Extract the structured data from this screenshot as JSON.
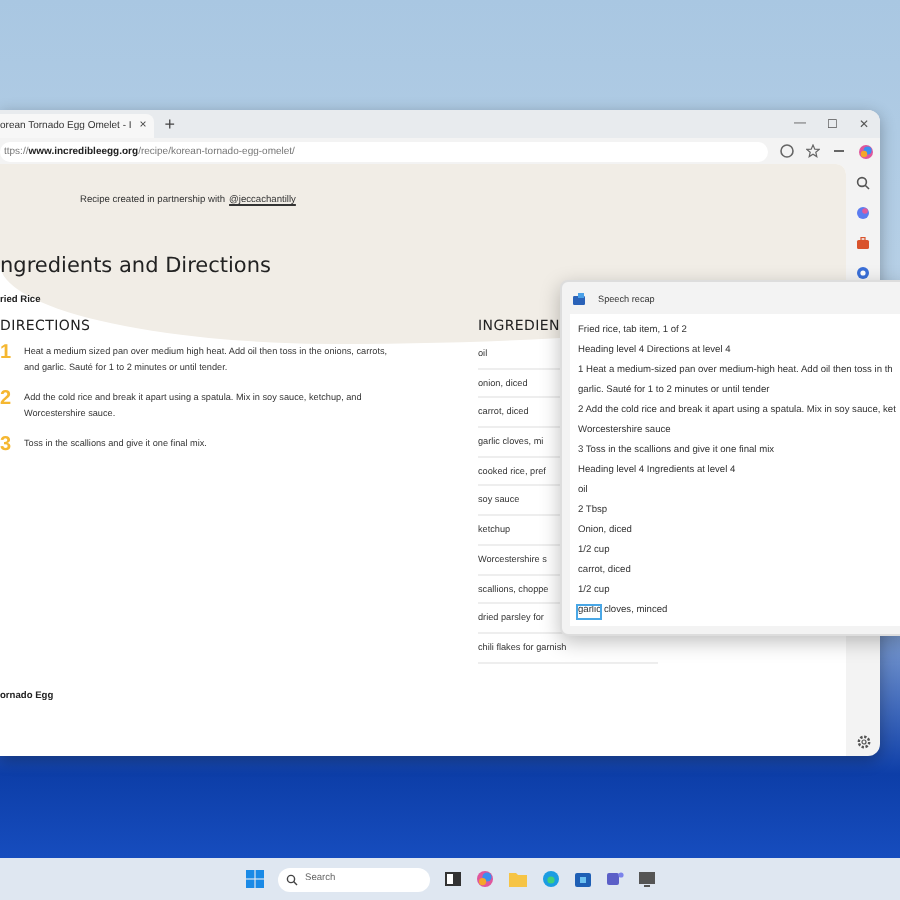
{
  "browser": {
    "tab": {
      "title": "orean Tornado Egg Omelet - I",
      "close": "×"
    },
    "new_tab": "+",
    "controls": [
      "—",
      "☐",
      "✕"
    ],
    "address": {
      "prefix": "ttps://",
      "domain": "www.incredibleegg.org",
      "path": "/recipe/korean-tornado-egg-omelet/"
    }
  },
  "page": {
    "partnership": {
      "text": "Recipe created in partnership with",
      "link": "@jeccachantilly"
    },
    "heading": "ngredients and Directions",
    "recipe_tab": "ried Rice",
    "directions": {
      "title": "DIRECTIONS",
      "steps": [
        {
          "number": "1",
          "text": "Heat a medium sized pan over medium high heat. Add oil then toss in the onions, carrots, and garlic. Sauté for 1 to 2 minutes or until tender."
        },
        {
          "number": "2",
          "text": "Add the cold rice and break it apart using a spatula. Mix in soy sauce, ketchup, and Worcestershire sauce."
        },
        {
          "number": "3",
          "text": "Toss in the scallions and give it one final mix."
        }
      ]
    },
    "ingredients": {
      "title": "INGREDIEN",
      "items": [
        "oil",
        "onion, diced",
        "carrot, diced",
        "garlic cloves, mi",
        "cooked rice, pref",
        "soy sauce",
        "ketchup",
        "Worcestershire s",
        "scallions, choppe",
        "dried parsley for",
        "chili flakes for garnish"
      ]
    },
    "next_recipe": "ornado Egg"
  },
  "speech_recap": {
    "title": "Speech recap",
    "lines": [
      {
        "text": "Fried rice, tab item, 1 of 2",
        "highlighted": false
      },
      {
        "text": "Heading level 4 Directions at level 4",
        "highlighted": false
      },
      {
        "text": "1 Heat a medium-sized pan over medium-high heat. Add oil then toss in th",
        "highlighted": false
      },
      {
        "text": "garlic. Sauté for 1 to 2 minutes or until tender",
        "highlighted": false
      },
      {
        "text": "2 Add the cold rice and break it apart using a spatula. Mix in soy sauce, ket",
        "highlighted": false
      },
      {
        "text": "Worcestershire sauce",
        "highlighted": false
      },
      {
        "text": "3 Toss in the scallions and give it one final mix",
        "highlighted": false
      },
      {
        "text": "Heading level 4 Ingredients at level 4",
        "highlighted": false
      },
      {
        "text": "oil",
        "highlighted": false
      },
      {
        "text": "2 Tbsp",
        "highlighted": false
      },
      {
        "text": "Onion, diced",
        "highlighted": false
      },
      {
        "text": "1/2 cup",
        "highlighted": false
      },
      {
        "text": "carrot, diced",
        "highlighted": false
      },
      {
        "text": "1/2 cup",
        "highlighted": false
      },
      {
        "text": "garlic",
        "rest": "cloves, minced",
        "highlighted": true
      }
    ]
  },
  "taskbar": {
    "search_placeholder": "Search"
  }
}
